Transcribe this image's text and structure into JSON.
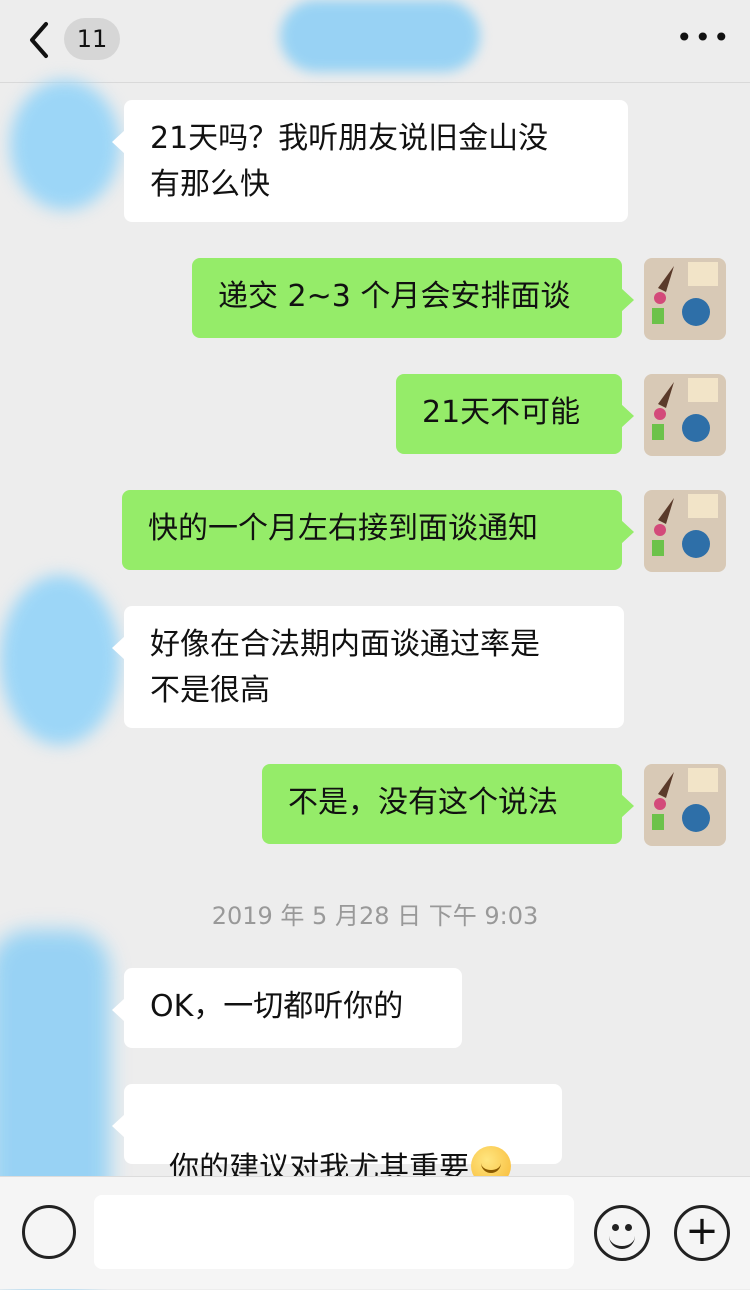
{
  "header": {
    "back_badge": "11",
    "more": "•••"
  },
  "messages": [
    {
      "side": "them",
      "text": "21天吗？我听朋友说旧金山没\n有那么快"
    },
    {
      "side": "me",
      "text": "递交 2~3 个月会安排面谈"
    },
    {
      "side": "me",
      "text": "21天不可能"
    },
    {
      "side": "me",
      "text": "快的一个月左右接到面谈通知"
    },
    {
      "side": "them",
      "text": "好像在合法期内面谈通过率是\n不是很高"
    },
    {
      "side": "me",
      "text": "不是，没有这个说法"
    },
    {
      "side": "them",
      "text": "OK，一切都听你的"
    },
    {
      "side": "them",
      "text": "你的建议对我尤其重要"
    }
  ],
  "timestamp": "2019 年 5 月28 日 下午 9:03",
  "input_bar": {
    "plus": "+"
  },
  "icons": [
    "back-icon",
    "more-icon",
    "voice-icon",
    "emoji-icon",
    "plus-icon",
    "smile-emoji-icon"
  ],
  "colors": {
    "background": "#ededed",
    "me_bubble": "#95ec69",
    "them_bubble": "#ffffff"
  }
}
